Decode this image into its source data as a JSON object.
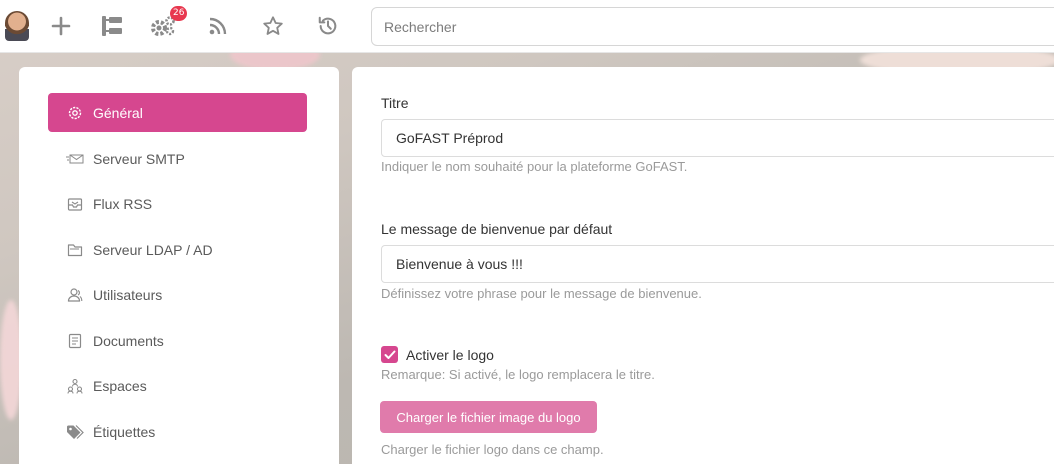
{
  "topbar": {
    "notifications_count": "26",
    "search_placeholder": "Rechercher",
    "icons": [
      "avatar",
      "plus-icon",
      "tree-icon",
      "gears-icon",
      "rss-icon",
      "star-icon",
      "history-icon"
    ]
  },
  "sidebar": {
    "items": [
      {
        "label": "Général",
        "icon": "gear-outline-icon",
        "active": true
      },
      {
        "label": "Serveur SMTP",
        "icon": "envelope-icon"
      },
      {
        "label": "Flux RSS",
        "icon": "inbox-icon"
      },
      {
        "label": "Serveur LDAP / AD",
        "icon": "folder-icon"
      },
      {
        "label": "Utilisateurs",
        "icon": "users-icon"
      },
      {
        "label": "Documents",
        "icon": "document-icon"
      },
      {
        "label": "Espaces",
        "icon": "spaces-icon"
      },
      {
        "label": "Étiquettes",
        "icon": "tags-icon"
      }
    ]
  },
  "form": {
    "title_label": "Titre",
    "title_value": "GoFAST Préprod",
    "title_help": "Indiquer le nom souhaité pour la plateforme GoFAST.",
    "welcome_label": "Le message de bienvenue par défaut",
    "welcome_value": "Bienvenue à vous !!!",
    "welcome_help": "Définissez votre phrase pour le message de bienvenue.",
    "logo_checkbox_label": "Activer le logo",
    "logo_checked": true,
    "logo_remark": "Remarque: Si activé, le logo remplacera le titre.",
    "upload_button_label": "Charger le fichier image du logo",
    "upload_help": "Charger le fichier logo dans ce champ."
  },
  "colors": {
    "accent": "#d6478f",
    "button": "#e07bab",
    "badge": "#e8384f"
  }
}
